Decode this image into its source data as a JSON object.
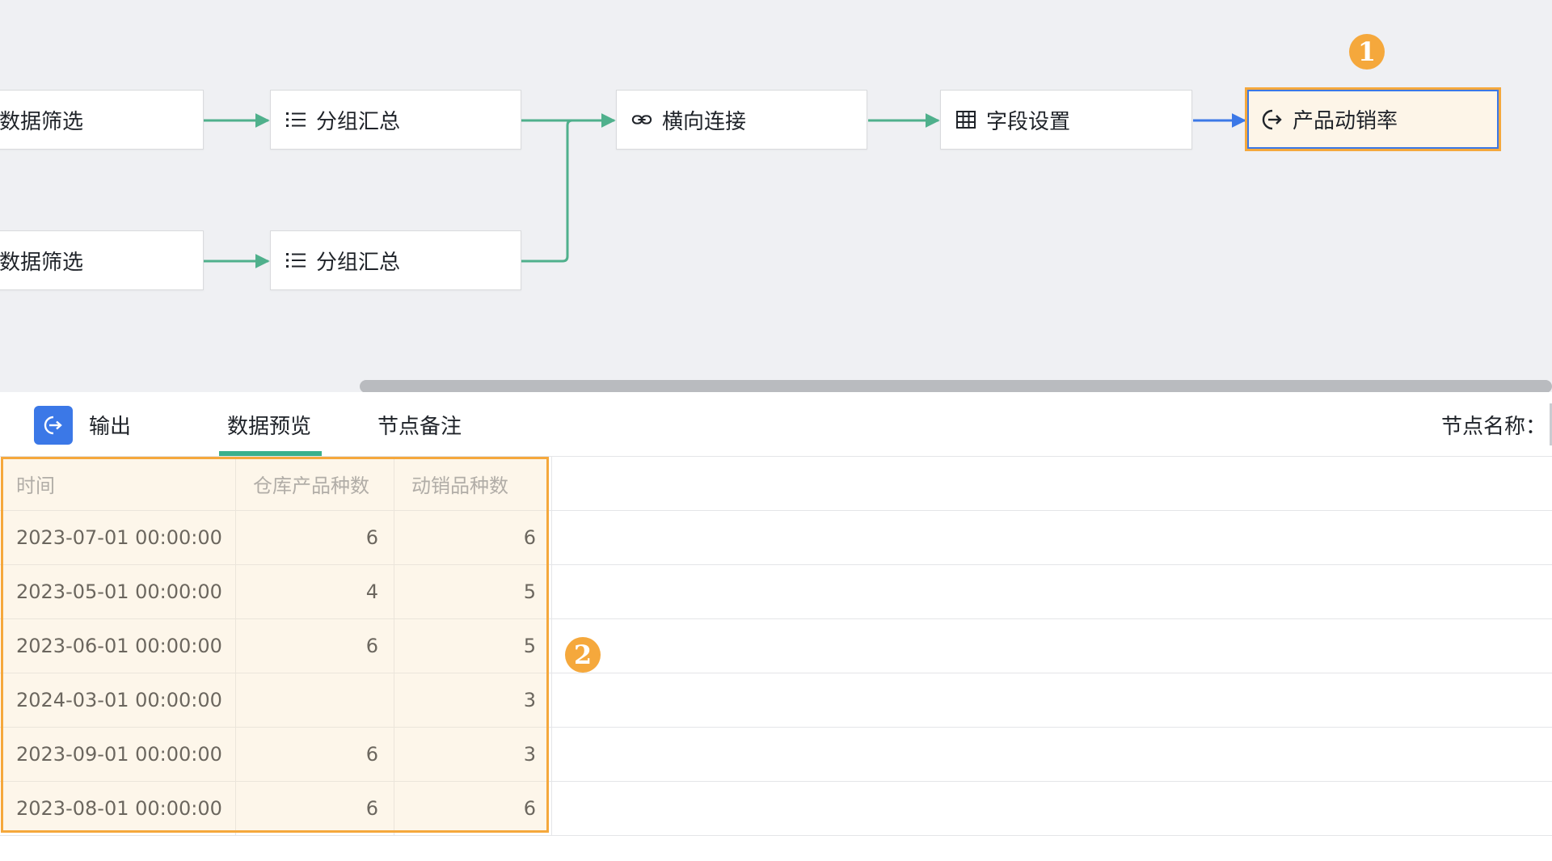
{
  "flow": {
    "nodes": [
      {
        "id": "filter1",
        "label": "数据筛选",
        "icon": "filter-icon"
      },
      {
        "id": "group1",
        "label": "分组汇总",
        "icon": "list-icon"
      },
      {
        "id": "join",
        "label": "横向连接",
        "icon": "link-icon"
      },
      {
        "id": "fields",
        "label": "字段设置",
        "icon": "table-icon"
      },
      {
        "id": "output",
        "label": "产品动销率",
        "icon": "output-icon",
        "selected": true
      },
      {
        "id": "filter2",
        "label": "数据筛选",
        "icon": "filter-icon"
      },
      {
        "id": "group2",
        "label": "分组汇总",
        "icon": "list-icon"
      }
    ],
    "badge1": "1",
    "badge2": "2"
  },
  "colors": {
    "edge": "#4fb08c",
    "edge_selected": "#3b78e7",
    "accent": "#f5a83c",
    "tab_active": "#3ab08c"
  },
  "panel": {
    "output_label": "输出",
    "tabs": [
      {
        "label": "数据预览",
        "active": true
      },
      {
        "label": "节点备注",
        "active": false
      }
    ],
    "node_name_label": "节点名称："
  },
  "table": {
    "columns": [
      "时间",
      "仓库产品种数",
      "动销品种数"
    ],
    "rows": [
      [
        "2023-07-01 00:00:00",
        "6",
        "6"
      ],
      [
        "2023-05-01 00:00:00",
        "4",
        "5"
      ],
      [
        "2023-06-01 00:00:00",
        "6",
        "5"
      ],
      [
        "2024-03-01 00:00:00",
        "",
        "3"
      ],
      [
        "2023-09-01 00:00:00",
        "6",
        "3"
      ],
      [
        "2023-08-01 00:00:00",
        "6",
        "6"
      ]
    ]
  }
}
